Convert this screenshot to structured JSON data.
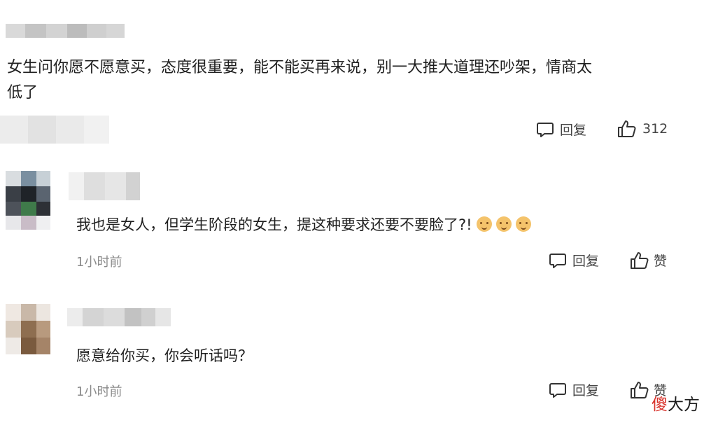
{
  "top_comment": {
    "text_line1": "女生问你愿不愿意买，态度很重要，能不能买再来说，别一大推大道理还吵架，情商太",
    "text_line2": "低了",
    "reply_label": "回复",
    "like_count": "312"
  },
  "replies": [
    {
      "text": "我也是女人，但学生阶段的女生，提这种要求还要不要脸了?!",
      "emoji_icons": [
        "smiling-cat-emoji",
        "smiling-cat-emoji",
        "smiling-cat-emoji"
      ],
      "time": "1小时前",
      "reply_label": "回复",
      "like_label": "赞"
    },
    {
      "text": "愿意给你买，你会听话吗？",
      "time": "1小时前",
      "reply_label": "回复",
      "like_label": "赞"
    }
  ],
  "watermark": {
    "part1": "傻",
    "part2": "大方"
  },
  "colors": {
    "text": "#1f1f1f",
    "muted": "#8a8a8a",
    "watermark_red": "#d8322a"
  }
}
